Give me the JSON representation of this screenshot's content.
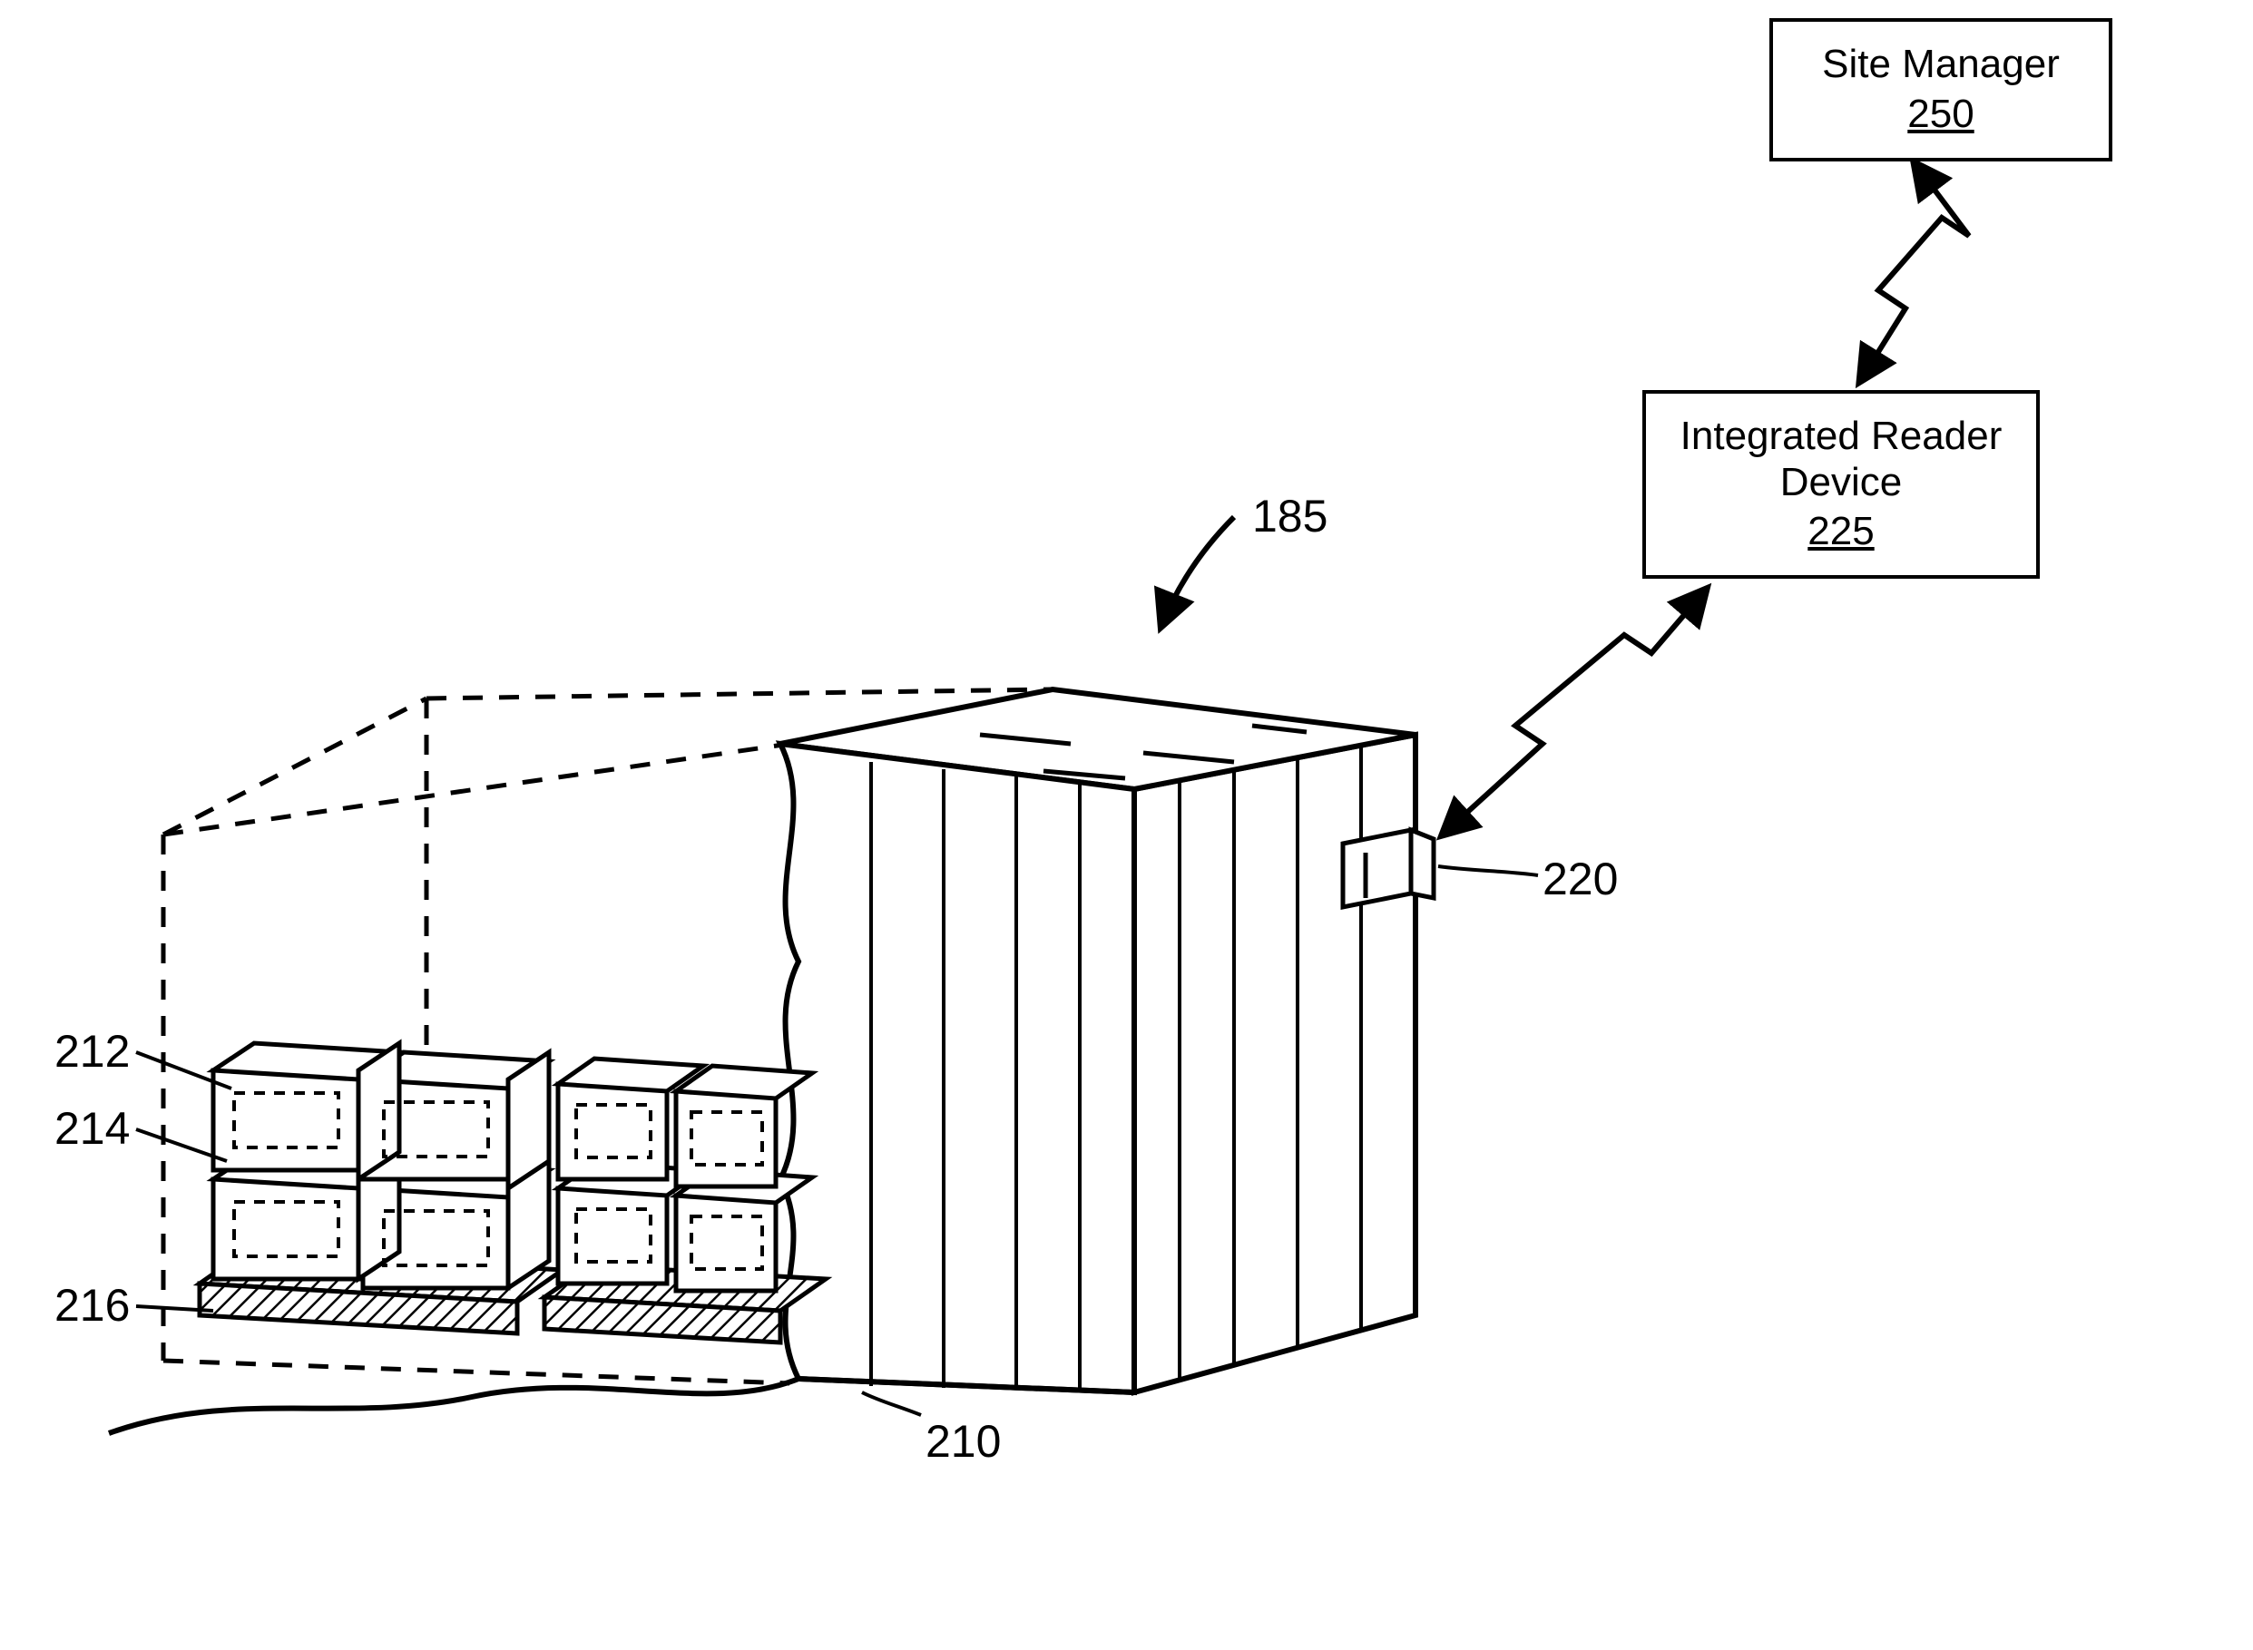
{
  "boxes": {
    "site_manager": {
      "title": "Site Manager",
      "ref": "250"
    },
    "integrated_reader": {
      "title_line1": "Integrated Reader",
      "title_line2": "Device",
      "ref": "225"
    }
  },
  "labels": {
    "n185": "185",
    "n210": "210",
    "n212": "212",
    "n214": "214",
    "n216": "216",
    "n220": "220"
  }
}
